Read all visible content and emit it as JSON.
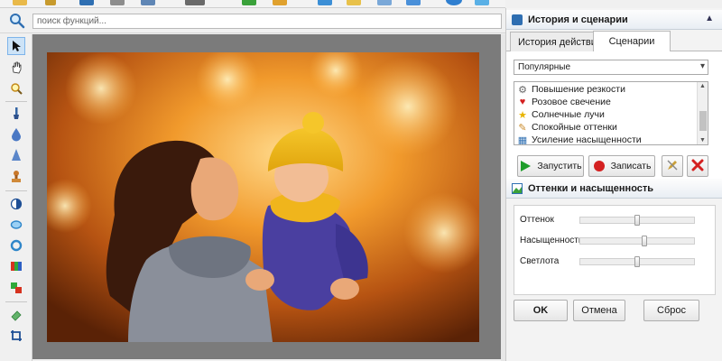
{
  "search": {
    "placeholder": "поиск функций...",
    "icon": "magnifier-icon"
  },
  "toolbar": {
    "icons": [
      "open-icon",
      "save-icon",
      "print-icon",
      "tools-icon",
      "effects-icon",
      "layers-icon",
      "help-icon",
      "cube-icon"
    ]
  },
  "tools": {
    "items": [
      "pointer-icon",
      "hand-icon",
      "zoom-icon",
      "brush-icon",
      "drop-icon",
      "cone-icon",
      "stamp-icon",
      "contrast-icon",
      "lens-icon",
      "ring-icon",
      "levels-icon",
      "color-swap-icon",
      "eraser-icon",
      "crop-icon"
    ]
  },
  "canvas": {
    "background": "#7b7b7b"
  },
  "history_panel": {
    "title": "История и сценарии",
    "collapse_symbol": "▲",
    "tabs": [
      "История действий",
      "Сценарии"
    ],
    "active_tab": "Сценарии",
    "dropdown_value": "Популярные",
    "scenarios": [
      {
        "label": "Повышение резкости",
        "icon": "gear-icon"
      },
      {
        "label": "Розовое свечение",
        "icon": "heart-icon"
      },
      {
        "label": "Солнечные лучи",
        "icon": "star-icon"
      },
      {
        "label": "Спокойные оттенки",
        "icon": "palette-icon"
      },
      {
        "label": "Усиление насыщенности",
        "icon": "color-chart-icon"
      }
    ],
    "buttons": {
      "run": "Запустить",
      "record": "Записать"
    }
  },
  "adjust_panel": {
    "title": "Оттенки и насыщенность",
    "sliders": [
      {
        "label": "Оттенок",
        "value": 0.5
      },
      {
        "label": "Насыщенность",
        "value": 0.57
      },
      {
        "label": "Светлота",
        "value": 0.5
      }
    ],
    "buttons": {
      "ok": "OK",
      "cancel": "Отмена",
      "reset": "Сброс"
    }
  },
  "colors": {
    "accent_blue": "#2f6fb2",
    "run_green": "#1e9d2a",
    "record_red": "#d42020"
  }
}
